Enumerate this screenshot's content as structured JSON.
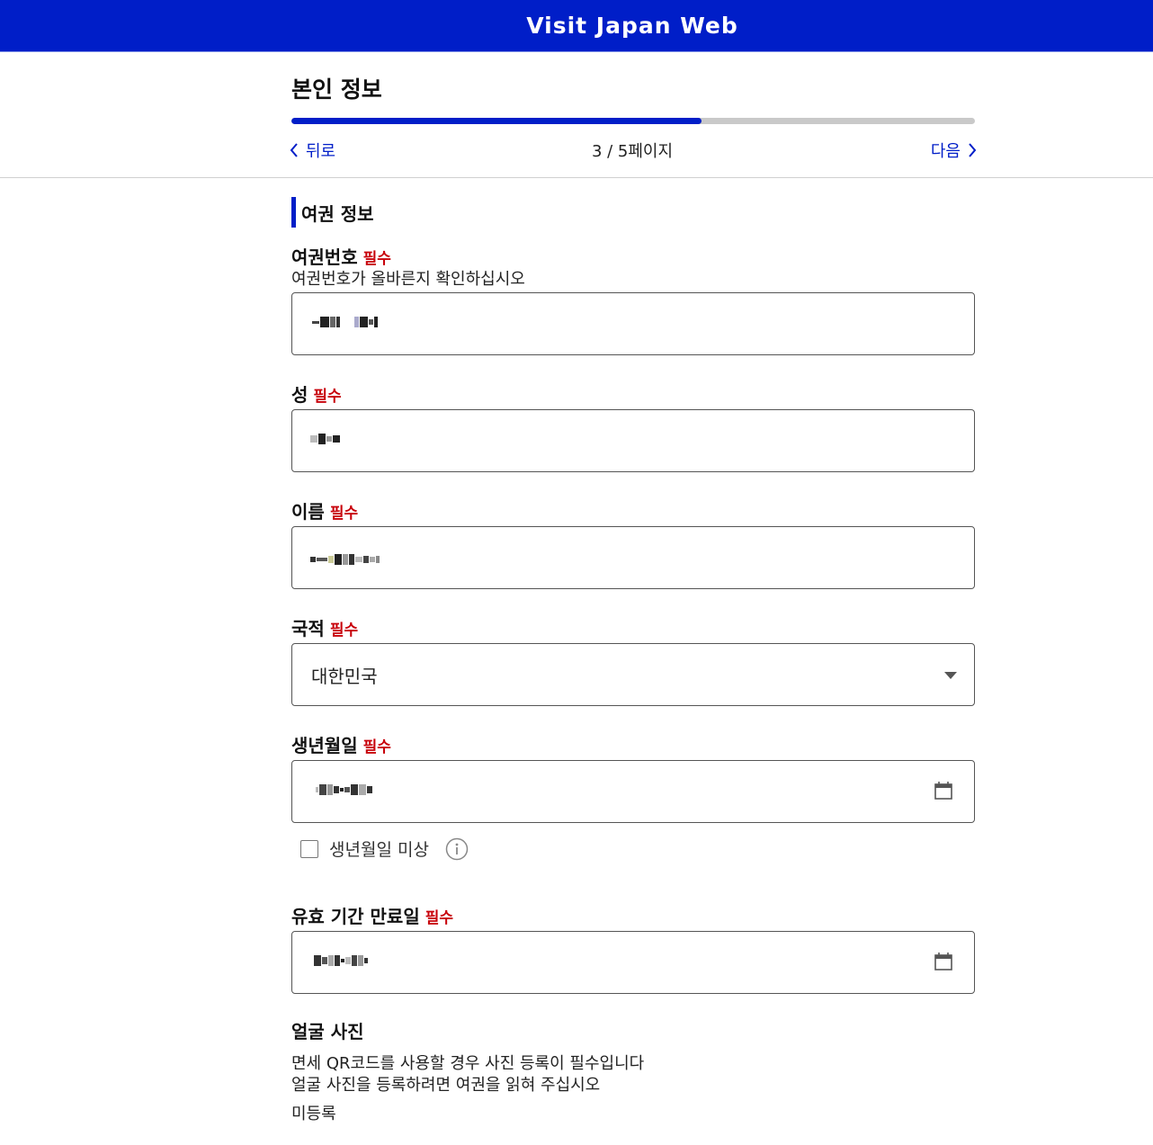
{
  "header": {
    "title": "Visit Japan Web",
    "bg_color": "#001ec8"
  },
  "topbar": {
    "title": "본인 정보",
    "progress": {
      "current": 3,
      "total": 5,
      "fraction": 0.6
    },
    "back_label": "뒤로",
    "next_label": "다음",
    "page_indicator": "3 / 5페이지"
  },
  "section": {
    "title": "여권 정보"
  },
  "required_label": "필수",
  "fields": {
    "passport_number": {
      "label": "여권번호",
      "hint": "여권번호가 올바른지 확인하십시오",
      "value_redacted": true
    },
    "surname": {
      "label": "성",
      "value_redacted": true
    },
    "given_name": {
      "label": "이름",
      "value_redacted": true
    },
    "nationality": {
      "label": "국적",
      "value": "대한민국"
    },
    "birth_date": {
      "label": "생년월일",
      "value_redacted": true,
      "icon": "calendar-icon"
    },
    "birth_unknown": {
      "label": "생년월일 미상",
      "checked": false,
      "icon": "info-icon"
    },
    "expiry_date": {
      "label": "유효 기간 만료일",
      "value_redacted": true,
      "icon": "calendar-icon"
    }
  },
  "face_photo": {
    "title": "얼굴 사진",
    "note_line1": "면세 QR코드를 사용할 경우 사진 등록이 필수입니다",
    "note_line2": "얼굴 사진을 등록하려면 여권을 읽혀 주십시오",
    "status": "미등록"
  },
  "colors": {
    "accent": "#001ec8",
    "required": "#c8000a"
  }
}
